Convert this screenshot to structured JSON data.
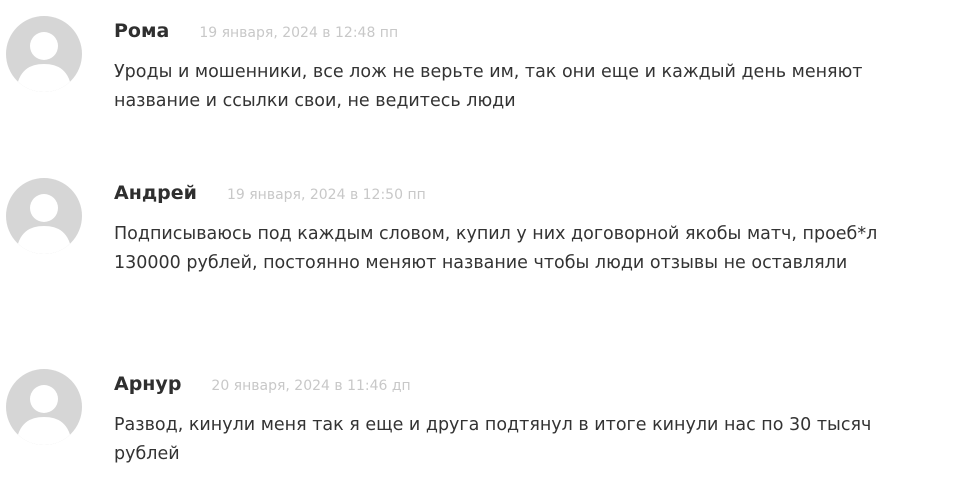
{
  "comments": [
    {
      "author": "Рома",
      "date": "19 января, 2024 в 12:48 пп",
      "text": "Уроды и мошенники, все лож не верьте им, так они еще и каждый день меняют название и ссылки свои, не ведитесь люди"
    },
    {
      "author": "Андрей",
      "date": "19 января, 2024 в 12:50 пп",
      "text": "Подписываюсь под каждым словом, купил у них договорной якобы матч, проеб*л 130000 рублей, постоянно меняют название чтобы люди отзывы не оставляли"
    },
    {
      "author": "Арнур",
      "date": "20 января, 2024 в 11:46 дп",
      "text": "Развод, кинули меня так я еще и друга подтянул в итоге кинули нас по 30 тысяч рублей"
    }
  ],
  "colors": {
    "avatar_bg": "#d6d6d6",
    "avatar_fg": "#ffffff",
    "date": "#c8c8c8",
    "author": "#2f2f2f",
    "text": "#333333"
  },
  "icons": {
    "avatar": "default-user-avatar-icon"
  }
}
